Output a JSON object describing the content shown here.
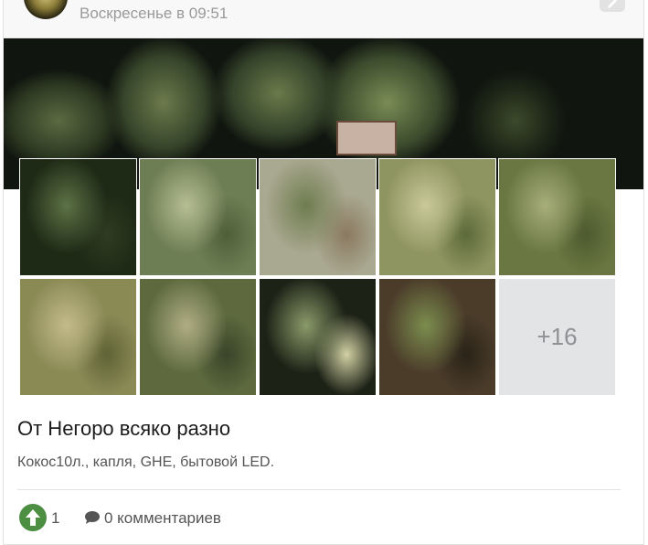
{
  "post": {
    "date": "Воскресенье в 09:51",
    "title": "От Негоро всяко разно",
    "description": "Кокос10л., капля, GHE, бытовой LED.",
    "likes": "1",
    "comments": "0 комментариев"
  },
  "gallery": {
    "more_label": "+16",
    "tiles": [
      {
        "name": "photo-1",
        "colors": [
          "#1e2a16",
          "#5d7245",
          "#2f3c22"
        ]
      },
      {
        "name": "photo-2",
        "colors": [
          "#6e7e54",
          "#b6bd93",
          "#4f5f38"
        ]
      },
      {
        "name": "photo-3",
        "colors": [
          "#a9a890",
          "#6f7c4f",
          "#8a7960"
        ]
      },
      {
        "name": "photo-4",
        "colors": [
          "#8f9560",
          "#c9c99a",
          "#5d6a3b"
        ]
      },
      {
        "name": "photo-5",
        "colors": [
          "#6a7742",
          "#a7ae7a",
          "#4e5a2f"
        ]
      },
      {
        "name": "photo-6",
        "colors": [
          "#8a8a55",
          "#c4bb8a",
          "#5f6336"
        ]
      },
      {
        "name": "photo-7",
        "colors": [
          "#5e6a3e",
          "#b0ad84",
          "#3a442a"
        ]
      },
      {
        "name": "photo-8",
        "colors": [
          "#1d2216",
          "#8a9a6a",
          "#d1d1a4"
        ]
      },
      {
        "name": "photo-9",
        "colors": [
          "#4b3c2a",
          "#7b8d4e",
          "#2a2318"
        ]
      }
    ]
  },
  "colors": {
    "like_green": "#4c8e42",
    "text_gray": "#555555",
    "date_gray": "#9a9a9a"
  }
}
